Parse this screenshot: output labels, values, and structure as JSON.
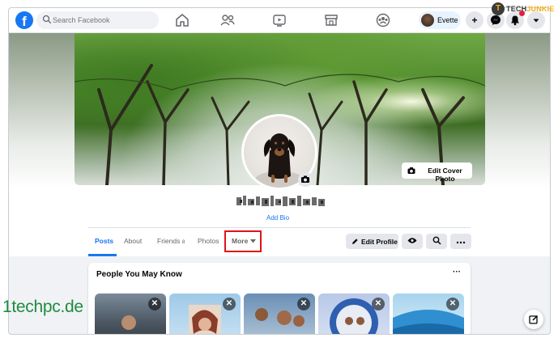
{
  "topbar": {
    "logo_letter": "f",
    "search": {
      "placeholder": "Search Facebook"
    },
    "nav_icons": [
      "home-icon",
      "friends-icon",
      "watch-icon",
      "marketplace-icon",
      "groups-icon"
    ],
    "user_name": "Evette",
    "action_icons": [
      "plus-icon",
      "messenger-icon",
      "bell-icon",
      "caret-down-icon"
    ]
  },
  "watermark": {
    "badge": "T",
    "text_a": "TECH",
    "text_b": "JUNKIE"
  },
  "profile": {
    "edit_cover_label": "Edit Cover Photo",
    "add_bio_label": "Add Bio"
  },
  "tabs": {
    "posts": "Posts",
    "about": "About",
    "friends": "Friends",
    "friends_count": "8",
    "photos": "Photos",
    "more": "More",
    "edit_profile": "Edit Profile"
  },
  "pymk": {
    "title": "People You May Know",
    "menu": "···",
    "close_glyph": "✕"
  },
  "site_watermark": "1techpc.de",
  "colors": {
    "brand_blue": "#1877f2",
    "highlight_red": "#e0131a",
    "watermark_green": "#1d8d3d"
  }
}
